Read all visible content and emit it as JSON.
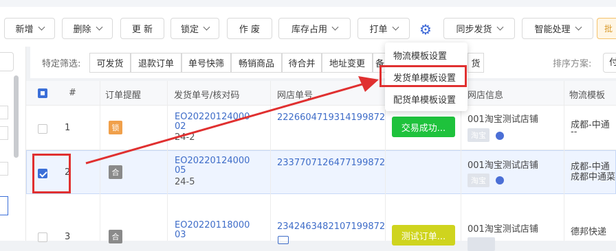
{
  "toolbar": {
    "buttons": [
      {
        "label": "新增",
        "caret": true
      },
      {
        "label": "删除",
        "caret": true
      },
      {
        "label": "更 新",
        "caret": false
      },
      {
        "label": "锁定",
        "caret": true
      },
      {
        "label": "作 废",
        "caret": false
      },
      {
        "label": "库存占用",
        "caret": true
      },
      {
        "label": "打单",
        "caret": true
      },
      {
        "label": "同步发货",
        "caret": true
      },
      {
        "label": "智能处理",
        "caret": true
      }
    ],
    "edge_label": "批"
  },
  "filters": {
    "label": "特定筛选:",
    "chips": [
      "可发货",
      "退款订单",
      "单号快筛",
      "畅销商品",
      "待合并",
      "地址变更",
      "备",
      "货"
    ],
    "sort_label": "排序方案:",
    "sort_value": "付"
  },
  "table": {
    "headers": [
      "#",
      "订单提醒",
      "发货单号/核对码",
      "网店单号",
      "网店信息",
      "物流模板"
    ],
    "rows": [
      {
        "num": "1",
        "tag": "锁",
        "tag_color": "#f0a04b",
        "order_no_line1": "EO20220124000",
        "order_no_line2": "02",
        "check_code": "24-2",
        "shop_order": "2226604719314199872",
        "status": "交易成功...",
        "status_color": "#1ec23c",
        "shop": "001淘宝测试店铺",
        "platform": "淘宝",
        "logistics_line1": "成都-中通",
        "logistics_line2": "--",
        "checked": false
      },
      {
        "num": "2",
        "tag": "合",
        "tag_color": "#8a8a8a",
        "order_no_line1": "EO20220124000",
        "order_no_line2": "05",
        "check_code": "24-5",
        "shop_order": "2337707126477199872",
        "status": "",
        "status_color": "",
        "shop": "001淘宝测试店铺",
        "platform": "淘宝",
        "logistics_line1": "成都-中通",
        "logistics_line2": "成都中通菜",
        "checked": true
      },
      {
        "num": "3",
        "tag": "合",
        "tag_color": "#8a8a8a",
        "order_no_line1": "EO20220118000",
        "order_no_line2": "03",
        "check_code": "",
        "shop_order": "2342463482107199872",
        "status": "测试订单...",
        "status_color": "#cfd41e",
        "shop": "001淘宝测试店铺",
        "platform": "",
        "logistics_line1": "德邦快递",
        "logistics_line2": "",
        "checked": false
      }
    ]
  },
  "print_menu": {
    "items": [
      "物流模板设置",
      "发货单模板设置",
      "配货单模板设置"
    ],
    "highlighted": "发货单模板设置"
  },
  "icons": {
    "settings": "gear-icon",
    "caret": "chevron-down-icon",
    "avatar": "round-avatar-icon"
  },
  "colors": {
    "accent": "#3b6fd8",
    "link": "#3e6cc8",
    "annotation": "#e03030",
    "success": "#1ec23c",
    "warning_tag": "#f0a04b"
  }
}
